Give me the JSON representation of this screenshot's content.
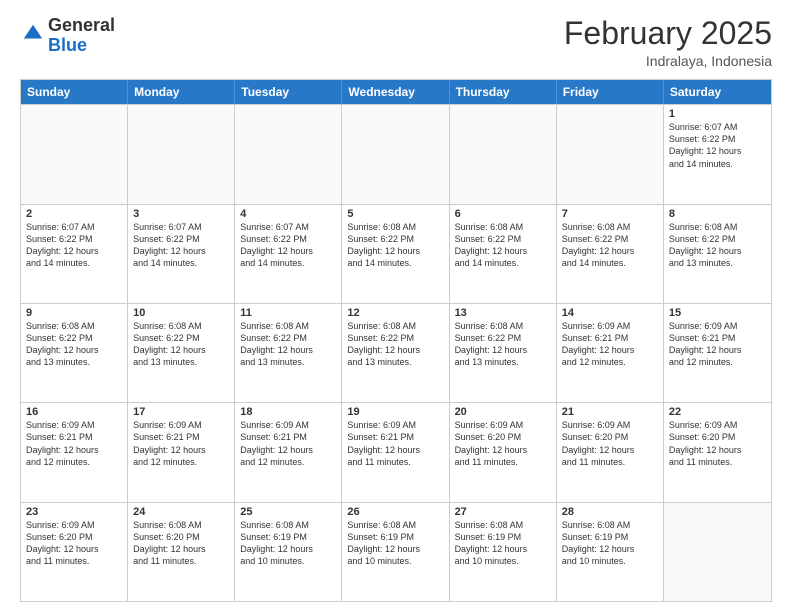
{
  "logo": {
    "line1": "General",
    "line2": "Blue"
  },
  "header": {
    "month": "February 2025",
    "location": "Indralaya, Indonesia"
  },
  "days": [
    "Sunday",
    "Monday",
    "Tuesday",
    "Wednesday",
    "Thursday",
    "Friday",
    "Saturday"
  ],
  "rows": [
    [
      {
        "day": "",
        "text": "",
        "empty": true
      },
      {
        "day": "",
        "text": "",
        "empty": true
      },
      {
        "day": "",
        "text": "",
        "empty": true
      },
      {
        "day": "",
        "text": "",
        "empty": true
      },
      {
        "day": "",
        "text": "",
        "empty": true
      },
      {
        "day": "",
        "text": "",
        "empty": true
      },
      {
        "day": "1",
        "text": "Sunrise: 6:07 AM\nSunset: 6:22 PM\nDaylight: 12 hours\nand 14 minutes.",
        "empty": false
      }
    ],
    [
      {
        "day": "2",
        "text": "Sunrise: 6:07 AM\nSunset: 6:22 PM\nDaylight: 12 hours\nand 14 minutes.",
        "empty": false
      },
      {
        "day": "3",
        "text": "Sunrise: 6:07 AM\nSunset: 6:22 PM\nDaylight: 12 hours\nand 14 minutes.",
        "empty": false
      },
      {
        "day": "4",
        "text": "Sunrise: 6:07 AM\nSunset: 6:22 PM\nDaylight: 12 hours\nand 14 minutes.",
        "empty": false
      },
      {
        "day": "5",
        "text": "Sunrise: 6:08 AM\nSunset: 6:22 PM\nDaylight: 12 hours\nand 14 minutes.",
        "empty": false
      },
      {
        "day": "6",
        "text": "Sunrise: 6:08 AM\nSunset: 6:22 PM\nDaylight: 12 hours\nand 14 minutes.",
        "empty": false
      },
      {
        "day": "7",
        "text": "Sunrise: 6:08 AM\nSunset: 6:22 PM\nDaylight: 12 hours\nand 14 minutes.",
        "empty": false
      },
      {
        "day": "8",
        "text": "Sunrise: 6:08 AM\nSunset: 6:22 PM\nDaylight: 12 hours\nand 13 minutes.",
        "empty": false
      }
    ],
    [
      {
        "day": "9",
        "text": "Sunrise: 6:08 AM\nSunset: 6:22 PM\nDaylight: 12 hours\nand 13 minutes.",
        "empty": false
      },
      {
        "day": "10",
        "text": "Sunrise: 6:08 AM\nSunset: 6:22 PM\nDaylight: 12 hours\nand 13 minutes.",
        "empty": false
      },
      {
        "day": "11",
        "text": "Sunrise: 6:08 AM\nSunset: 6:22 PM\nDaylight: 12 hours\nand 13 minutes.",
        "empty": false
      },
      {
        "day": "12",
        "text": "Sunrise: 6:08 AM\nSunset: 6:22 PM\nDaylight: 12 hours\nand 13 minutes.",
        "empty": false
      },
      {
        "day": "13",
        "text": "Sunrise: 6:08 AM\nSunset: 6:22 PM\nDaylight: 12 hours\nand 13 minutes.",
        "empty": false
      },
      {
        "day": "14",
        "text": "Sunrise: 6:09 AM\nSunset: 6:21 PM\nDaylight: 12 hours\nand 12 minutes.",
        "empty": false
      },
      {
        "day": "15",
        "text": "Sunrise: 6:09 AM\nSunset: 6:21 PM\nDaylight: 12 hours\nand 12 minutes.",
        "empty": false
      }
    ],
    [
      {
        "day": "16",
        "text": "Sunrise: 6:09 AM\nSunset: 6:21 PM\nDaylight: 12 hours\nand 12 minutes.",
        "empty": false
      },
      {
        "day": "17",
        "text": "Sunrise: 6:09 AM\nSunset: 6:21 PM\nDaylight: 12 hours\nand 12 minutes.",
        "empty": false
      },
      {
        "day": "18",
        "text": "Sunrise: 6:09 AM\nSunset: 6:21 PM\nDaylight: 12 hours\nand 12 minutes.",
        "empty": false
      },
      {
        "day": "19",
        "text": "Sunrise: 6:09 AM\nSunset: 6:21 PM\nDaylight: 12 hours\nand 11 minutes.",
        "empty": false
      },
      {
        "day": "20",
        "text": "Sunrise: 6:09 AM\nSunset: 6:20 PM\nDaylight: 12 hours\nand 11 minutes.",
        "empty": false
      },
      {
        "day": "21",
        "text": "Sunrise: 6:09 AM\nSunset: 6:20 PM\nDaylight: 12 hours\nand 11 minutes.",
        "empty": false
      },
      {
        "day": "22",
        "text": "Sunrise: 6:09 AM\nSunset: 6:20 PM\nDaylight: 12 hours\nand 11 minutes.",
        "empty": false
      }
    ],
    [
      {
        "day": "23",
        "text": "Sunrise: 6:09 AM\nSunset: 6:20 PM\nDaylight: 12 hours\nand 11 minutes.",
        "empty": false
      },
      {
        "day": "24",
        "text": "Sunrise: 6:08 AM\nSunset: 6:20 PM\nDaylight: 12 hours\nand 11 minutes.",
        "empty": false
      },
      {
        "day": "25",
        "text": "Sunrise: 6:08 AM\nSunset: 6:19 PM\nDaylight: 12 hours\nand 10 minutes.",
        "empty": false
      },
      {
        "day": "26",
        "text": "Sunrise: 6:08 AM\nSunset: 6:19 PM\nDaylight: 12 hours\nand 10 minutes.",
        "empty": false
      },
      {
        "day": "27",
        "text": "Sunrise: 6:08 AM\nSunset: 6:19 PM\nDaylight: 12 hours\nand 10 minutes.",
        "empty": false
      },
      {
        "day": "28",
        "text": "Sunrise: 6:08 AM\nSunset: 6:19 PM\nDaylight: 12 hours\nand 10 minutes.",
        "empty": false
      },
      {
        "day": "",
        "text": "",
        "empty": true
      }
    ]
  ]
}
